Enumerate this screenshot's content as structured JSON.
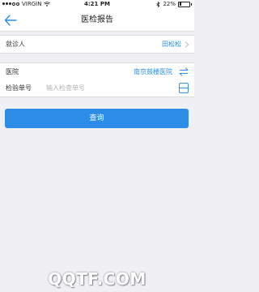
{
  "status_bar": {
    "carrier": "VIRGIN",
    "time": "4:21 PM",
    "battery_percent": "22%",
    "battery_level": 0.22
  },
  "nav": {
    "back_icon": "back-arrow-icon",
    "title": "医检报告"
  },
  "form": {
    "patient": {
      "label": "就诊人",
      "value": "田松松"
    },
    "hospital": {
      "label": "医院",
      "value": "南京鼓楼医院",
      "icon": "switch-icon"
    },
    "report_no": {
      "label": "检验单号",
      "placeholder": "输入检查单号",
      "value": "",
      "icon": "scan-icon"
    }
  },
  "actions": {
    "query_label": "查询"
  },
  "colors": {
    "accent": "#2d8ce6",
    "link": "#2a8ee8",
    "background": "#efeff4"
  },
  "watermark": {
    "text": "QQTF.COM"
  }
}
